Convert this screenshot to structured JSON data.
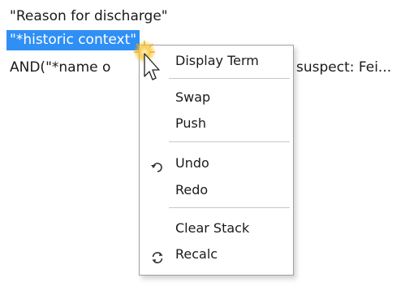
{
  "text_lines": {
    "line1": "\"Reason for discharge\"",
    "line2": "\"*historic context\"",
    "line3_left": "AND(\"*name o",
    "line3_right": "suspect: Fei..."
  },
  "context_menu": {
    "items": [
      {
        "label": "Display Term",
        "icon": ""
      },
      {
        "label": "Swap",
        "icon": ""
      },
      {
        "label": "Push",
        "icon": ""
      },
      {
        "label": "Undo",
        "icon": "undo-icon"
      },
      {
        "label": "Redo",
        "icon": ""
      },
      {
        "label": "Clear Stack",
        "icon": ""
      },
      {
        "label": "Recalc",
        "icon": "recalc-icon"
      }
    ]
  },
  "colors": {
    "selection": "#2f8ff5",
    "cursor_glow": "#f5b400"
  }
}
